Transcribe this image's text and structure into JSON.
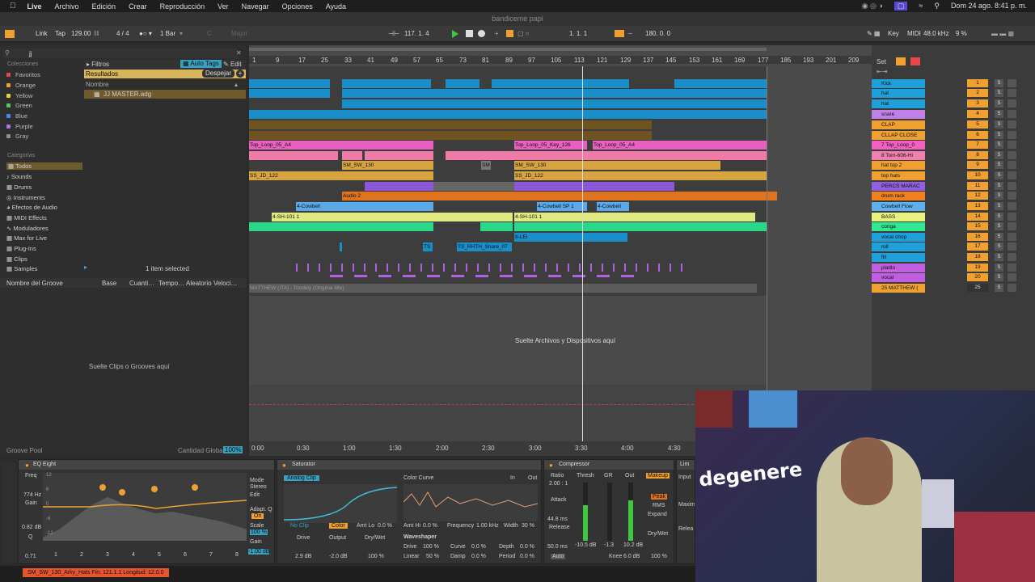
{
  "menubar": {
    "app": "Live",
    "items": [
      "Archivo",
      "Edición",
      "Crear",
      "Reproducción",
      "Ver",
      "Navegar",
      "Opciones",
      "Ayuda"
    ],
    "datetime": "Dom 24 ago.  8:41 p. m."
  },
  "window_title": "bandiceme papi",
  "transport": {
    "link": "Link",
    "tap": "Tap",
    "bpm": "129.00",
    "signature": "4 / 4",
    "quantize": "1 Bar",
    "key": "C",
    "scale": "Major",
    "position": "117.   1.   4",
    "position2": "1.   1.   1",
    "loop_length": "180.   0.   0",
    "key_label": "Key",
    "midi_label": "MIDI",
    "sample_rate": "48.0 kHz",
    "cpu": "9 %"
  },
  "browser": {
    "collections_header": "Colecciones",
    "collections": [
      {
        "label": "Favoritos",
        "color": "#e84848"
      },
      {
        "label": "Orange",
        "color": "#f0a030"
      },
      {
        "label": "Yellow",
        "color": "#e8d040"
      },
      {
        "label": "Green",
        "color": "#58c858"
      },
      {
        "label": "Blue",
        "color": "#4888e8"
      },
      {
        "label": "Purple",
        "color": "#a870e0"
      },
      {
        "label": "Gray",
        "color": "#909090"
      }
    ],
    "categories_header": "Categorías",
    "categories": [
      "Todos",
      "Sounds",
      "Drums",
      "Instruments",
      "Efectos de Audio",
      "MIDI Effects",
      "Moduladores",
      "Max for Live",
      "Plug-Ins",
      "Clips",
      "Samples"
    ],
    "search_value": "jj",
    "filters": "Filtros",
    "auto_tags": "Auto Tags",
    "edit": "Edit",
    "results": "Resultados",
    "clear": "Despejar",
    "name_col": "Nombre",
    "result_item": "JJ MASTER.adg",
    "selection": "1 item selected",
    "groove_cols": [
      "Nombre del Groove",
      "Base",
      "Cuanti…",
      "Tempo…",
      "Aleatorio",
      "Veloci…"
    ],
    "groove_drop": "Suelte Clips o Grooves aquí",
    "groove_pool": "Groove Pool",
    "global_amount": "Cantidad Global",
    "global_amount_value": "100%"
  },
  "ruler": [
    "1",
    "9",
    "17",
    "25",
    "33",
    "41",
    "49",
    "57",
    "65",
    "73",
    "81",
    "89",
    "97",
    "105",
    "113",
    "121",
    "129",
    "137",
    "145",
    "153",
    "161",
    "169",
    "177",
    "185",
    "193",
    "201",
    "209"
  ],
  "time_ruler": [
    "0:00",
    "0:30",
    "1:00",
    "1:30",
    "2:00",
    "2:30",
    "3:00",
    "3:30",
    "4:00",
    "4:30"
  ],
  "arrangement_drop": "Suelte Archivos y Dispositivos aquí",
  "set_label": "Set",
  "clip_labels": {
    "top_loop": "Top_Loop_05_A4",
    "top_loop_key": "Top_Loop_05_Key_126",
    "sm": "SM_SW_130",
    "sm_short": "SM",
    "ss": "SS_JD_122",
    "audio2": "Audio 2",
    "cowbell": "4-Cowbell",
    "cowbell_sp": "4-Cowbell SP 1",
    "sh101": "4-SH-101 1",
    "sh10": "4-SH-10",
    "ts": "TS",
    "ts_rhth": "TS_RHTH_Snare_07",
    "vocal": "8-LEI",
    "matthew": "MATTHEW (ITA) - Toodely (Original Mix)"
  },
  "tracks": [
    {
      "name": "Kick",
      "num": "1",
      "color": "#20a0d8"
    },
    {
      "name": "hat",
      "num": "2",
      "color": "#20a0d8"
    },
    {
      "name": "hat",
      "num": "3",
      "color": "#20a0d8"
    },
    {
      "name": "snare",
      "num": "4",
      "color": "#c080e8"
    },
    {
      "name": "CLAP",
      "num": "5",
      "color": "#f0a030"
    },
    {
      "name": "CLLAP CLOSE",
      "num": "6",
      "color": "#f0a030"
    },
    {
      "name": "7 Top_Loop_0",
      "num": "7",
      "color": "#f060c0"
    },
    {
      "name": "8 Tom-606-Hi",
      "num": "8",
      "color": "#f080b0"
    },
    {
      "name": "hat top 2",
      "num": "9",
      "color": "#f0a030"
    },
    {
      "name": "top hats",
      "num": "10",
      "color": "#f0a030"
    },
    {
      "name": "PERCS MARAC",
      "num": "11",
      "color": "#9060e0"
    },
    {
      "name": "drum rack",
      "num": "12",
      "color": "#f08020"
    },
    {
      "name": "Cowbell Flow",
      "num": "13",
      "color": "#60b0f0"
    },
    {
      "name": "BASS",
      "num": "14",
      "color": "#e8f080"
    },
    {
      "name": "conga",
      "num": "15",
      "color": "#30e890"
    },
    {
      "name": "vocal chop",
      "num": "16",
      "color": "#20a0d8"
    },
    {
      "name": "roll",
      "num": "17",
      "color": "#20a0d8"
    },
    {
      "name": "fill",
      "num": "18",
      "color": "#20a0d8"
    },
    {
      "name": "platito",
      "num": "19",
      "color": "#c060e0"
    },
    {
      "name": "vocal",
      "num": "20",
      "color": "#c060e0"
    },
    {
      "name": "25 MATTHEW (",
      "num": "25",
      "color": "#f0a030"
    }
  ],
  "devices": {
    "eq": {
      "title": "EQ Eight",
      "freq_label": "Freq",
      "freq": "774 Hz",
      "gain_label": "Gain",
      "gain": "0.82 dB",
      "q_label": "Q",
      "q": "0.71",
      "mode_label": "Mode",
      "mode": "Stereo",
      "edit": "Edit",
      "adapt": "Adapt. Q",
      "on": "On",
      "scale": "Scale",
      "scale_val": "100 %",
      "gain2": "Gain",
      "gain2_val": "-1.00 dB",
      "axis": [
        "12",
        "6",
        "0",
        "-6",
        "-12"
      ],
      "bands": [
        "1",
        "2",
        "3",
        "4",
        "5",
        "6",
        "7",
        "8"
      ]
    },
    "sat": {
      "title": "Saturator",
      "curve": "Analog Clip",
      "color_curve": "Color Curve",
      "in": "In",
      "out": "Out",
      "noclip": "No Clip",
      "color": "Color",
      "amtlo": "Amt Lo",
      "amtlo_val": "0.0 %",
      "drive": "Drive",
      "drive_val": "2.9 dB",
      "output": "Output",
      "output_val": "-2.0 dB",
      "drywet": "Dry/Wet",
      "drywet_val": "100 %",
      "amthi": "Amt Hi",
      "amthi_val": "0.0 %",
      "freq": "Frequency",
      "freq_val": "1.00 kHz",
      "width": "Width",
      "width_val": "30 %",
      "waveshaper": "Waveshaper",
      "ws_drive": "Drive",
      "ws_drive_val": "100 %",
      "ws_curve": "Curve",
      "ws_curve_val": "0.0 %",
      "ws_depth": "Depth",
      "ws_depth_val": "0.0 %",
      "ws_linear": "Linear",
      "ws_linear_val": "50 %",
      "ws_damp": "Damp",
      "ws_damp_val": "0.0 %",
      "ws_period": "Period",
      "ws_period_val": "0.0 %"
    },
    "comp": {
      "title": "Compressor",
      "ratio": "Ratio",
      "ratio_val": "2.00 : 1",
      "attack": "Attack",
      "attack_val": "44.8 ms",
      "release": "Release",
      "release_val": "50.0 ms",
      "auto": "Auto",
      "thresh": "Thresh",
      "thresh_val": "-10.5 dB",
      "gr": "GR",
      "gr_val": "-1.3",
      "out": "Out",
      "out_val": "10.2 dB",
      "makeup": "Makeup",
      "peak": "Peak",
      "rms": "RMS",
      "expand": "Expand",
      "knee": "Knee",
      "knee_val": "6.0 dB",
      "drywet": "Dry/Wet",
      "drywet_val": "100 %"
    },
    "lim": {
      "title": "Lim",
      "input": "Input",
      "maxim": "Maxim",
      "relea": "Relea"
    }
  },
  "status_clip": "SM_SW_130_Arky_Hats Fin: 121.1.1 Longitud: 12.0.0",
  "webcam": {
    "sticker_text": "degenere"
  }
}
